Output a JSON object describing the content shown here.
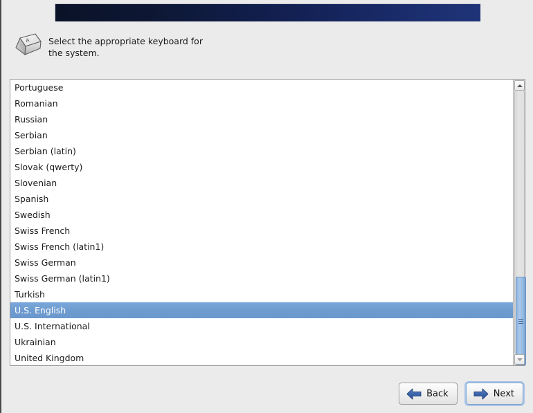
{
  "window": {
    "background_color": "#ebebeb"
  },
  "banner": {
    "name": "title-banner",
    "gradient_start": "#0a1228",
    "gradient_end": "#1f3478"
  },
  "instruction": {
    "icon": "keyboard-key-icon",
    "text": "Select the appropriate keyboard for\nthe system."
  },
  "keyboard_list": {
    "selected": "U.S. English",
    "selected_color": "#6f9cd0",
    "items": [
      "Portuguese",
      "Romanian",
      "Russian",
      "Serbian",
      "Serbian (latin)",
      "Slovak (qwerty)",
      "Slovenian",
      "Spanish",
      "Swedish",
      "Swiss French",
      "Swiss French (latin1)",
      "Swiss German",
      "Swiss German (latin1)",
      "Turkish",
      "U.S. English",
      "U.S. International",
      "Ukrainian",
      "United Kingdom"
    ]
  },
  "scrollbar": {
    "up_icon": "scroll-up-arrow-icon",
    "down_icon": "scroll-down-arrow-icon",
    "thumb_color": "#95bbe3"
  },
  "buttons": {
    "back": {
      "label": "Back",
      "icon": "arrow-left-icon"
    },
    "next": {
      "label": "Next",
      "icon": "arrow-right-icon",
      "focused": true
    }
  }
}
